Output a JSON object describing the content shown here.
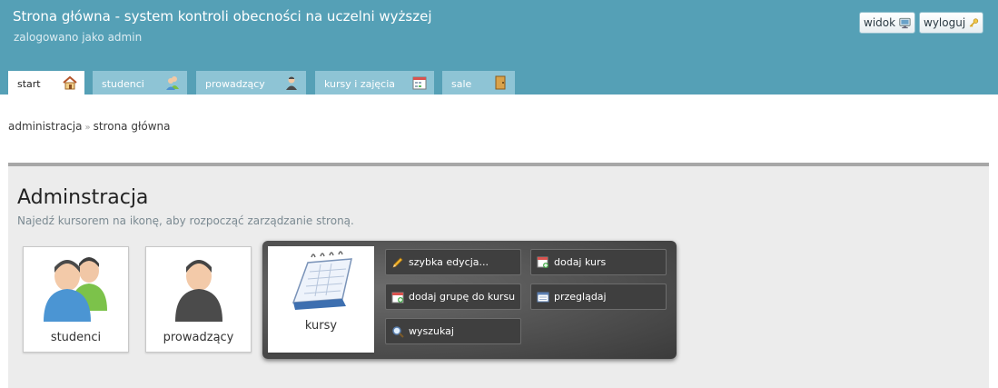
{
  "header": {
    "title": "Strona główna - system kontroli obecności na uczelni wyższej",
    "logged_as": "zalogowano jako admin",
    "view_button": "widok",
    "logout_button": "wyloguj"
  },
  "tabs": [
    {
      "label": "start",
      "icon": "home-icon",
      "active": true
    },
    {
      "label": "studenci",
      "icon": "users-icon",
      "active": false
    },
    {
      "label": "prowadzący",
      "icon": "teacher-icon",
      "active": false
    },
    {
      "label": "kursy i zajęcia",
      "icon": "calendar-icon",
      "active": false
    },
    {
      "label": "sale",
      "icon": "door-icon",
      "active": false
    }
  ],
  "breadcrumb": {
    "items": [
      "administracja",
      "strona główna"
    ],
    "separator": "»"
  },
  "panel": {
    "title": "Adminstracja",
    "hint": "Najedź kursorem na ikonę, aby rozpocząć zarządzanie stroną.",
    "tiles": {
      "studenci": "studenci",
      "prowadzacy": "prowadzący",
      "kursy": "kursy"
    },
    "kursy_actions": {
      "quick_edit": "szybka edycja...",
      "add_course": "dodaj kurs",
      "add_group": "dodaj grupę do kursu",
      "browse": "przeglądaj",
      "search": "wyszukaj"
    }
  },
  "colors": {
    "header_bg": "#55a0b6",
    "tab_bg": "#8ec4d5",
    "panel_bg": "#ececec",
    "submenu_bg": "#3f3f3f"
  }
}
